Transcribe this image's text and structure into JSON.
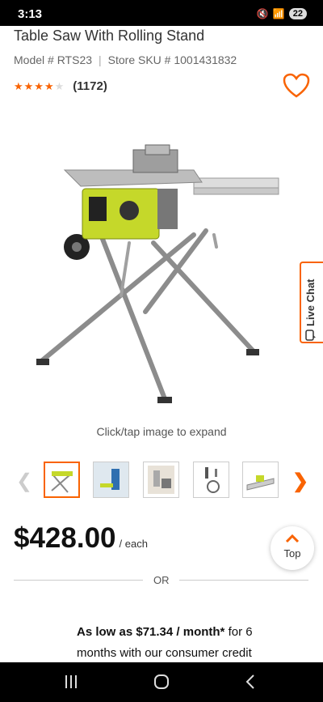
{
  "status_bar": {
    "time": "3:13",
    "battery": "22"
  },
  "product": {
    "title": "Table Saw With Rolling Stand",
    "model": "Model # RTS23",
    "store_sku": "Store SKU # 1001431832",
    "rating": 4.5,
    "review_count": "(1172)",
    "expand_hint": "Click/tap image to expand",
    "price": "$428.00",
    "price_unit": "/ each"
  },
  "live_chat": {
    "label": "Live Chat"
  },
  "top_button": {
    "label": "Top"
  },
  "separator": {
    "label": "OR"
  },
  "credit": {
    "bold_text": "As low as $71.34 / month*",
    "rest_text": " for 6 months with our consumer credit"
  },
  "thumbnails": [
    "saw-on-stand",
    "person-using-saw",
    "saw-in-room",
    "accessories",
    "saw-top-view"
  ],
  "colors": {
    "brand_orange": "#f96302",
    "saw_green": "#c5d82a"
  },
  "icons": [
    "heart-icon",
    "chat-icon",
    "chevron-left-icon",
    "chevron-right-icon",
    "chevron-up-icon"
  ]
}
